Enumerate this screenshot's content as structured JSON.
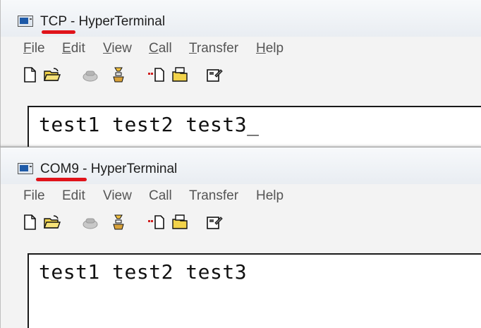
{
  "windows": [
    {
      "id": "tcp",
      "title_name": "TCP",
      "title_suffix": " - HyperTerminal",
      "menu": [
        {
          "first": "F",
          "rest": "ile"
        },
        {
          "first": "E",
          "rest": "dit"
        },
        {
          "first": "V",
          "rest": "iew"
        },
        {
          "first": "C",
          "rest": "all"
        },
        {
          "first": "T",
          "rest": "ransfer"
        },
        {
          "first": "H",
          "rest": "elp"
        }
      ],
      "terminal_text": "test1 test2 test3_"
    },
    {
      "id": "com9",
      "title_name": "COM9",
      "title_suffix": " - HyperTerminal",
      "menu": [
        "File",
        "Edit",
        "View",
        "Call",
        "Transfer",
        "Help"
      ],
      "terminal_text": "test1 test2 test3"
    }
  ],
  "toolbar_icons": [
    "new-file-icon",
    "open-folder-icon",
    "phone-icon",
    "disconnect-icon",
    "send-file-icon",
    "receive-file-icon",
    "properties-icon"
  ],
  "colors": {
    "annotation": "#e0131a",
    "menu_text": "#555555"
  }
}
